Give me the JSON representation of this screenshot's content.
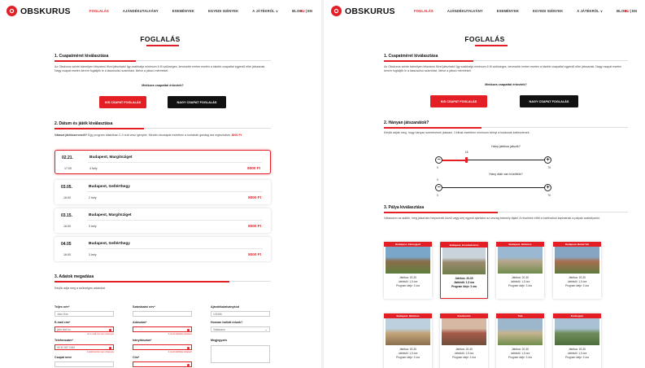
{
  "brand": "OBSKURUS",
  "colors": {
    "accent": "#e31e24",
    "dark": "#111111"
  },
  "nav": {
    "items": [
      "FOGLALÁS",
      "AJÁNDÉKUTALVÁNY",
      "ESEMÉNYEK",
      "EGYEDI IGÉNYEK",
      "A JÁTÉKRÓL ∨",
      "BLOG"
    ],
    "active": "FOGLALÁS",
    "lang_hu": "HU",
    "lang_sep": " | ",
    "lang_en": "EN"
  },
  "page_title": "FOGLALÁS",
  "left": {
    "s1": {
      "heading": "1. Csapatméret kiválasztása",
      "text": "Az Obskurus szinte bármilyen létszámú fővel játszható! Így szabhatja minimum 6 fő szükséges, kevesebb ember esetén a kisebb csapattal egyenlő elbe játszanak. Nagy csapat esetén kérem foglaljék le a lassúsúlsú számítást, illetve a játszó méreteket.",
      "question": "Mekkora csapattal érkeztek?",
      "btn_small": "KIS CSAPAT FOGLALÁS",
      "btn_big": "NAGY CSAPAT FOGLALÁS"
    },
    "s2": {
      "heading": "2. Dátum és játék kiválasztása",
      "note_bold": "Választ játékszervezőt?",
      "note": " Egy program átlaköban 2-3 órát vesz igénybe. Minden kiscsapat esetében a kurtabab gazdag ára regisztrálva:",
      "note_price": "8000 Ft",
      "cards": [
        {
          "date": "02.21.",
          "loc": "Budapest, Margitsziget",
          "time": "17:00",
          "seats": "4 hely",
          "price": "8000 Ft",
          "selected": true
        },
        {
          "date": "03.05.",
          "loc": "Budapest, Gellérthegy",
          "time": "16:00",
          "seats": "2 hely",
          "price": "8000 Ft",
          "selected": false
        },
        {
          "date": "03.15.",
          "loc": "Budapest, Margitsziget",
          "time": "16:00",
          "seats": "3 hely",
          "price": "8000 Ft",
          "selected": false
        },
        {
          "date": "04.05",
          "loc": "Budapest, Gellérthegy",
          "time": "16:00",
          "seats": "3 hely",
          "price": "8000 Ft",
          "selected": false
        }
      ]
    },
    "s3": {
      "heading": "3. Adatok megadása",
      "text": "Kérjük adja meg a szükséges adatokat.",
      "f_name_label": "Teljes név*",
      "f_name_val": "John Doe",
      "f_email_label": "E-mail cím*",
      "f_email_val": "john.doe.hu",
      "f_email_err": "Az e-mail cím nem érvényes",
      "f_phone_label": "Telefonszám*",
      "f_phone_val": "06 30 567 0040",
      "f_phone_err": "A telefonszám nem érvényes",
      "f_company_label": "Csapat neve",
      "f_billing_label": "Számlázási név*",
      "f_tax_label": "Adószám*",
      "f_tax_err": "A mező kitöltése kötelező",
      "f_zip_label": "Irányítószám*",
      "f_zip_err": "A mező kitöltése kötelező",
      "f_city_label": "Cím*",
      "f_voucher_label": "Ajándékutalványkód",
      "f_voucher_val": "123456",
      "f_how_label": "Honnan hallott rólunk?",
      "f_how_val": "Válasszon",
      "f_msg_label": "Megjegyzés"
    }
  },
  "right": {
    "s1": {
      "heading": "1. Csapatméret kiválasztása",
      "text": "Az Obskurus szinte bármilyen létszámú fővel játszható! Így szabhatja minimum 6 fő szükséges, kevesebb ember esetén a kisebb csapattal egyenlő elbe játszanak. Nagy csapat esetén kérem foglaljék le a lassúsúlsú számítást, illetve a játszó méreteket.",
      "question": "Mekkora csapattal érkeztek?",
      "btn_small": "KIS CSAPAT FOGLALÁS",
      "btn_big": "NAGY CSAPAT FOGLALÁS"
    },
    "s2": {
      "heading": "2. Hányan játszanátok?",
      "text": "Kérjük adják meg, hogy hányan szeretnének játszani. Céltrak esetében minimum kétnyi a tudásnak kellesztenek.",
      "q1": "Hány játékos játszik?",
      "q1_value": 18,
      "q1_value_label": "18",
      "q1_min": "0",
      "q1_max": "70",
      "q1_max_value": 70,
      "q2": "Hány diák van közöttük?",
      "q2_value": 0,
      "q2_value_label": "0",
      "q2_min": "0",
      "q2_max": "70",
      "q2_max_value": 70
    },
    "s3": {
      "heading": "3. Pálya kiválasztása",
      "text": "Válasszon az alábbi, még játszható helyszínek közül vagy kérj egyedi ajánlatot az ország bármely táján! A részletek előtt a tudnivalóst kaphatnak a pályák szabályairól.",
      "tiles": [
        {
          "name": "Budapest, Várnegyed",
          "players": "Játékos: 20-35",
          "time": "Játékidő: 1,5 óra",
          "program": "Program ideje: 3 óra",
          "colors": [
            "#7aa6c9",
            "#8a6c4a",
            "#5f7f3f"
          ],
          "selected": false
        },
        {
          "name": "Budapest, Erzsébetváros",
          "players": "Játékos: 20-35",
          "time": "Játékidő: 1,5 óra",
          "program": "Program ideje: 3 óra",
          "colors": [
            "#c9d3db",
            "#9a8a6c",
            "#6e7e4a"
          ],
          "selected": true
        },
        {
          "name": "Budapest, Belváros",
          "players": "Játékos: 20-35",
          "time": "Játékidő: 1,5 óra",
          "program": "Program ideje: 3 óra",
          "colors": [
            "#9ab8d2",
            "#b7a58a",
            "#6f8c4e"
          ],
          "selected": false
        },
        {
          "name": "Budapest, Budai Vár",
          "players": "Játékos: 20-35",
          "time": "Játékidő: 1,5 óra",
          "program": "Program ideje: 3 óra",
          "colors": [
            "#86a5c3",
            "#a86e50",
            "#5f7a3f"
          ],
          "selected": false
        },
        {
          "name": "Budapest, Belváros",
          "players": "Játékos: 20-35",
          "time": "Játékidő: 1,5 óra",
          "program": "Program ideje: 3 óra",
          "colors": [
            "#bcd0de",
            "#c4a57a",
            "#8a6f4e"
          ],
          "selected": false
        },
        {
          "name": "Szentendre",
          "players": "Játékos: 20-35",
          "time": "Játékidő: 1,5 óra",
          "program": "Program ideje: 3 óra",
          "colors": [
            "#d7b9a3",
            "#a65a4a",
            "#6e4e3a"
          ],
          "selected": false
        },
        {
          "name": "Tata",
          "players": "Játékos: 20-35",
          "time": "Játékidő: 1,5 óra",
          "program": "Program ideje: 3 óra",
          "colors": [
            "#9cb7cc",
            "#c6b48f",
            "#6f8d4d"
          ],
          "selected": false
        },
        {
          "name": "Esztergom",
          "players": "Játékos: 20-35",
          "time": "Játékidő: 1,5 óra",
          "program": "Program ideje: 3 óra",
          "colors": [
            "#a8c1d3",
            "#6e8d5a",
            "#4f6e3f"
          ],
          "selected": false
        }
      ]
    }
  }
}
